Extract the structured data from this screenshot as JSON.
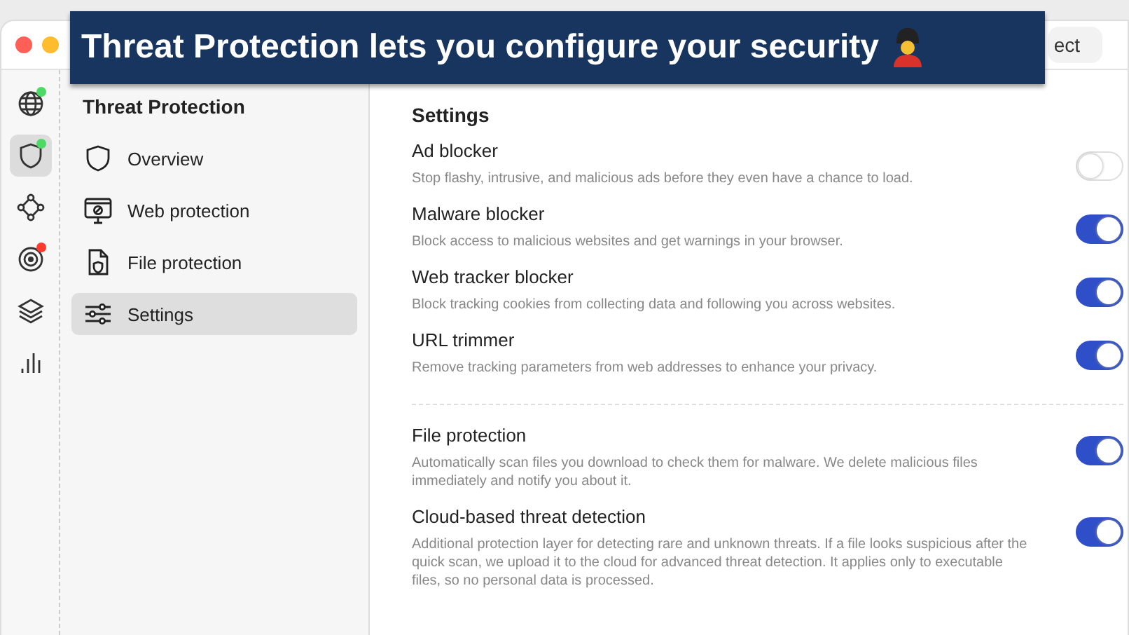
{
  "banner": {
    "text": "Threat Protection lets you configure your security"
  },
  "window": {
    "top_button": "ect"
  },
  "rail": [
    {
      "kind": "globe",
      "selected": false,
      "color": "#4cd964"
    },
    {
      "kind": "shield",
      "selected": true,
      "color": "#4cd964"
    },
    {
      "kind": "mesh",
      "selected": false
    },
    {
      "kind": "target",
      "selected": false,
      "color": "#ff3b30"
    },
    {
      "kind": "layers",
      "selected": false
    },
    {
      "kind": "bars",
      "selected": false
    }
  ],
  "sidebar": {
    "title": "Threat Protection",
    "items": [
      {
        "label": "Overview",
        "kind": "shield",
        "selected": false
      },
      {
        "label": "Web protection",
        "kind": "monitor",
        "selected": false
      },
      {
        "label": "File protection",
        "kind": "file",
        "selected": false
      },
      {
        "label": "Settings",
        "kind": "sliders",
        "selected": true
      }
    ]
  },
  "content": {
    "title": "Settings",
    "groups": [
      [
        {
          "name": "Ad blocker",
          "description": "Stop flashy, intrusive, and malicious ads before they even have a chance to load.",
          "on": false
        },
        {
          "name": "Malware blocker",
          "description": "Block access to malicious websites and get warnings in your browser.",
          "on": true
        },
        {
          "name": "Web tracker blocker",
          "description": "Block tracking cookies from collecting data and following you across websites.",
          "on": true
        },
        {
          "name": "URL trimmer",
          "description": "Remove tracking parameters from web addresses to enhance your privacy.",
          "on": true
        }
      ],
      [
        {
          "name": "File protection",
          "description": "Automatically scan files you download to check them for malware. We delete malicious files immediately and notify you about it.",
          "on": true
        },
        {
          "name": "Cloud-based threat detection",
          "description": "Additional protection layer for detecting rare and unknown threats. If a file looks suspicious after the quick scan, we upload it to the cloud for advanced threat detection. It applies only to executable files, so no personal data is processed.",
          "on": true
        }
      ]
    ]
  }
}
